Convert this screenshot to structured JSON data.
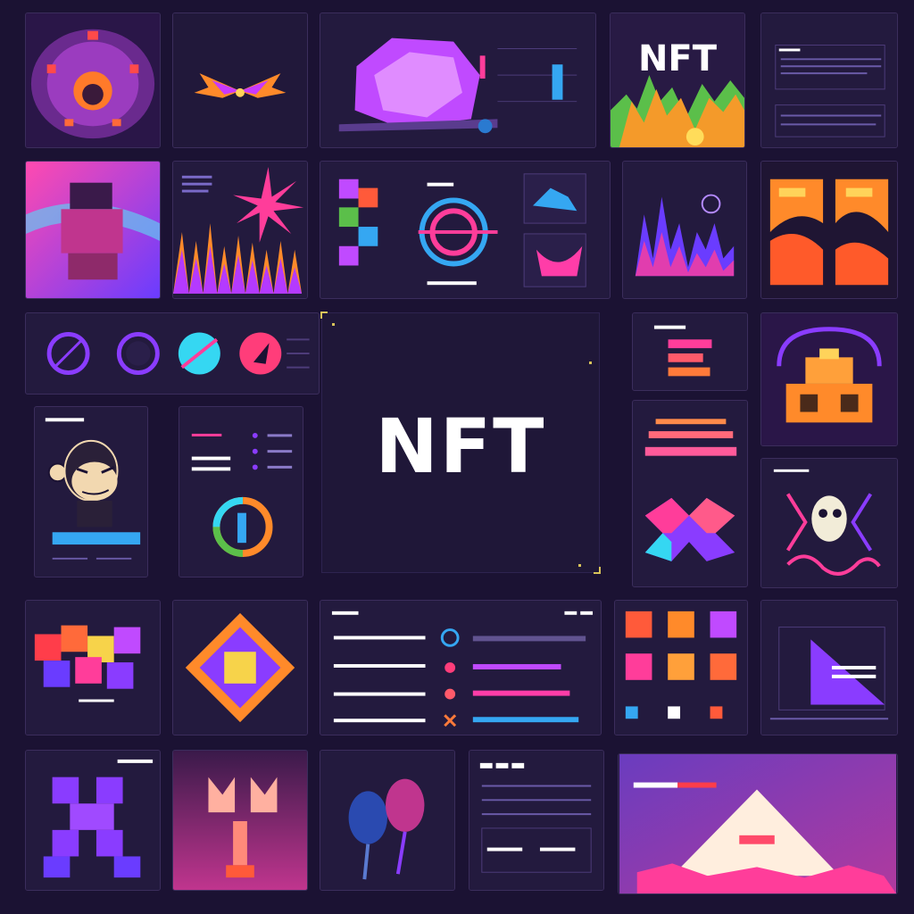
{
  "center": {
    "title": "NFT"
  },
  "card_nft": {
    "label": "NFT"
  },
  "colors": {
    "background": "#1b1233",
    "tile": "#231a3e",
    "accent_pink": "#ff3d9a",
    "accent_purple": "#8a3cff",
    "accent_cyan": "#35d7f2",
    "accent_orange": "#ff8a2a",
    "accent_yellow": "#f7d34a"
  },
  "icons": [
    "ape-avatar-icon",
    "target-icon",
    "arrow-icon",
    "eye-icon",
    "skull-icon",
    "diamond-icon"
  ]
}
